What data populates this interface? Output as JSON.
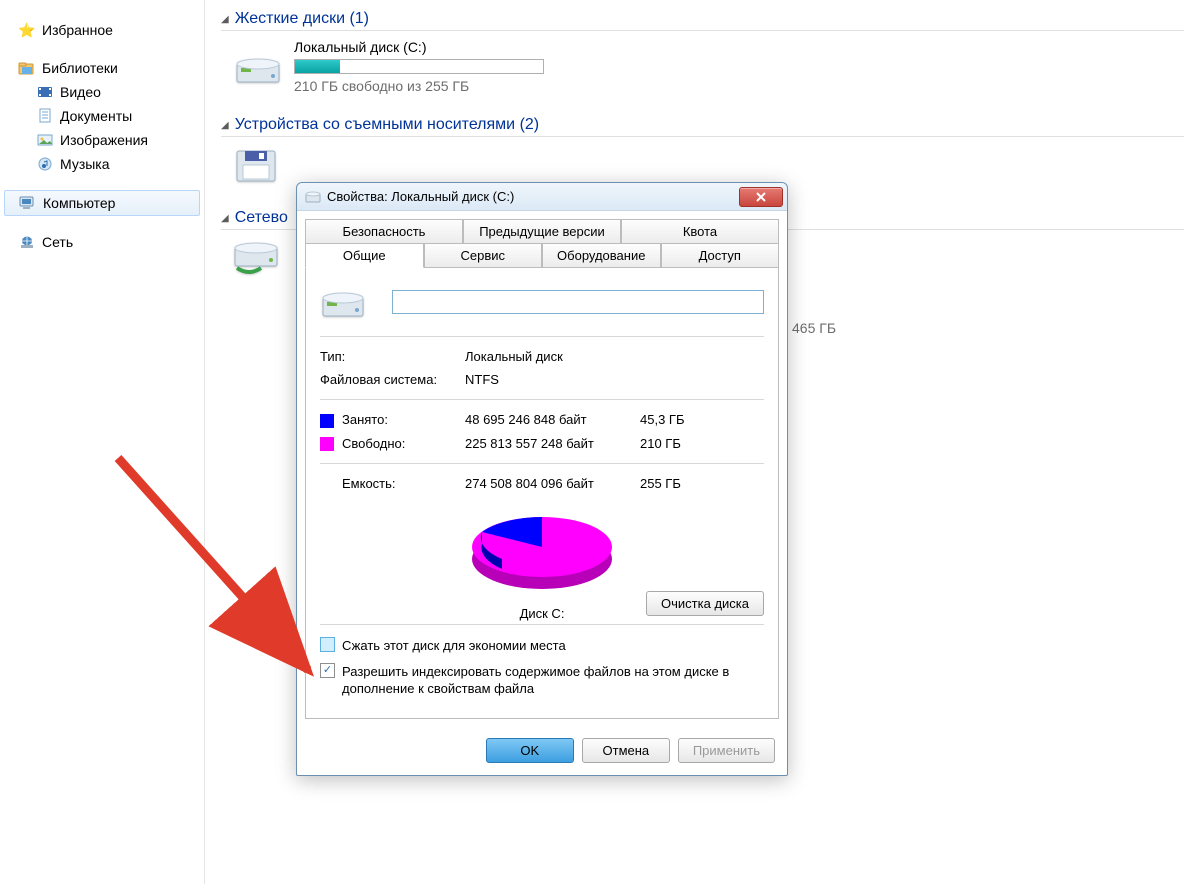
{
  "sidebar": {
    "groups": [
      {
        "label": "Избранное",
        "icon": "star-icon"
      },
      {
        "label": "Библиотеки",
        "icon": "libraries-icon",
        "children": [
          {
            "label": "Видео",
            "icon": "video-icon"
          },
          {
            "label": "Документы",
            "icon": "documents-icon"
          },
          {
            "label": "Изображения",
            "icon": "images-icon"
          },
          {
            "label": "Музыка",
            "icon": "music-icon"
          }
        ]
      },
      {
        "label": "Компьютер",
        "icon": "computer-icon",
        "selected": true
      },
      {
        "label": "Сеть",
        "icon": "network-icon"
      }
    ]
  },
  "sections": {
    "hdd": {
      "title": "Жесткие диски (1)"
    },
    "removable": {
      "title": "Устройства со съемными носителями (2)"
    },
    "netloc": {
      "title": "Сетево"
    }
  },
  "drive_c": {
    "name": "Локальный диск (C:)",
    "free_text": "210 ГБ свободно из 255 ГБ",
    "fill_pct": 18
  },
  "net_fragment": "465 ГБ",
  "dialog": {
    "title": "Свойства: Локальный диск (C:)",
    "tabs_top": [
      "Безопасность",
      "Предыдущие версии",
      "Квота"
    ],
    "tabs_bot": [
      "Общие",
      "Сервис",
      "Оборудование",
      "Доступ"
    ],
    "active_tab": "Общие",
    "name_value": "",
    "type_label": "Тип:",
    "type_value": "Локальный диск",
    "fs_label": "Файловая система:",
    "fs_value": "NTFS",
    "used_label": "Занято:",
    "used_bytes": "48 695 246 848 байт",
    "used_gb": "45,3 ГБ",
    "free_label": "Свободно:",
    "free_bytes": "225 813 557 248 байт",
    "free_gb": "210 ГБ",
    "cap_label": "Емкость:",
    "cap_bytes": "274 508 804 096 байт",
    "cap_gb": "255 ГБ",
    "pie_caption": "Диск C:",
    "cleanup_btn": "Очистка диска",
    "compress_label": "Сжать этот диск для экономии места",
    "index_label": "Разрешить индексировать содержимое файлов на этом диске в дополнение к свойствам файла",
    "ok": "OK",
    "cancel": "Отмена",
    "apply": "Применить"
  },
  "chart_data": {
    "type": "pie",
    "title": "Диск C:",
    "series": [
      {
        "name": "Занято",
        "value_bytes": 48695246848,
        "value_gb": 45.3,
        "color": "#0000fe"
      },
      {
        "name": "Свободно",
        "value_bytes": 225813557248,
        "value_gb": 210,
        "color": "#ff00ff"
      }
    ],
    "total_bytes": 274508804096,
    "total_gb": 255
  }
}
